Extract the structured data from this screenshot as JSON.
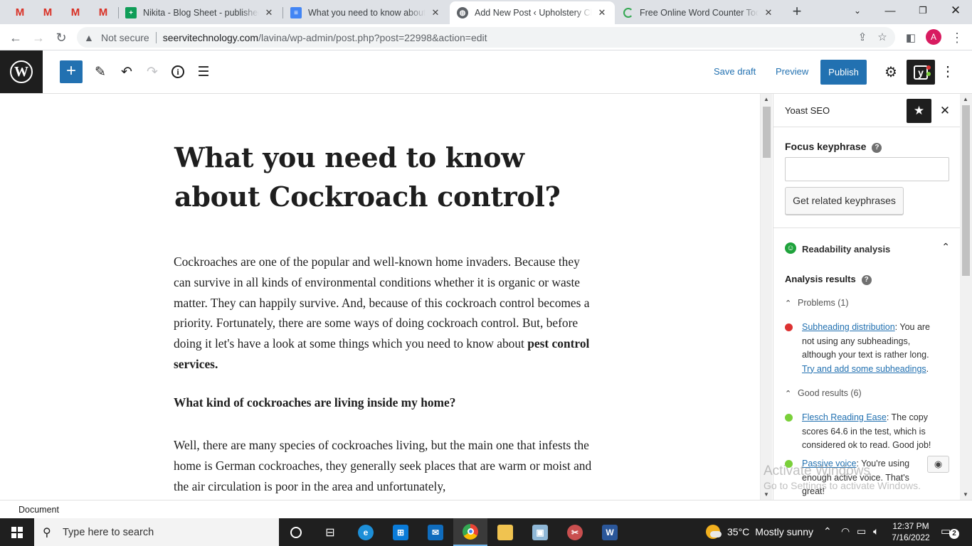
{
  "browser": {
    "pinned_tabs": [
      {
        "icon": "gmail-icon",
        "letter": "M"
      },
      {
        "icon": "gmail-icon",
        "letter": "M"
      },
      {
        "icon": "gmail-icon",
        "letter": "M"
      },
      {
        "icon": "gmail-icon",
        "letter": "M"
      }
    ],
    "tabs": [
      {
        "title": "Nikita - Blog Sheet - published",
        "icon": "google-sheets-icon",
        "color": "#0f9d58",
        "active": false
      },
      {
        "title": "What you need to know about C",
        "icon": "google-docs-icon",
        "color": "#4285f4",
        "active": false
      },
      {
        "title": "Add New Post ‹ Upholstery Clea",
        "icon": "globe-icon",
        "color": "#5f6368",
        "active": true
      },
      {
        "title": "Free Online Word Counter Tool:",
        "icon": "loading-icon",
        "color": "#34a853",
        "active": false
      }
    ],
    "new_tab_glyph": "+",
    "security_label": "Not secure",
    "url_host": "seervitechnology.com",
    "url_path": "/lavina/wp-admin/post.php?post=22998&action=edit",
    "profile_initial": "A"
  },
  "editor": {
    "toolbar": {
      "save_draft": "Save draft",
      "preview": "Preview",
      "publish": "Publish",
      "add_block_glyph": "+"
    },
    "post": {
      "title": "What you need to know about Cockroach control?",
      "intro": "Cockroaches are one of the popular and well-known home invaders. Because they can survive in all kinds of environmental conditions whether it is organic or waste matter. They can happily survive. And, because of this cockroach control becomes a priority. Fortunately, there are some ways of doing cockroach control. But, before doing it let's have a look at some things which you need to know about ",
      "intro_bold": "pest control services.",
      "heading": "What kind of cockroaches are living inside my home?",
      "para2": "Well, there are many species of cockroaches living, but the main one that infests the home is German cockroaches, they generally seek places that are warm or moist and the air circulation is poor in the area and unfortunately,"
    },
    "breadcrumb": "Document"
  },
  "yoast": {
    "panel_title": "Yoast SEO",
    "focus_label": "Focus keyphrase",
    "focus_value": "",
    "related_button": "Get related keyphrases",
    "readability_label": "Readability analysis",
    "analysis_label": "Analysis results",
    "problems_label": "Problems (1)",
    "good_label": "Good results (6)",
    "results": [
      {
        "status": "problem",
        "color": "#dc3232",
        "link": "Subheading distribution",
        "text": ": You are not using any subheadings, although your text is rather long. ",
        "link2": "Try and add some subheadings",
        "tail": "."
      },
      {
        "status": "good",
        "color": "#7ad03a",
        "link": "Flesch Reading Ease",
        "text": ": The copy scores 64.6 in the test, which is considered ok to read. Good job!"
      },
      {
        "status": "good",
        "color": "#7ad03a",
        "link": "Passive voice",
        "text": ": You're using enough active voice. That's great!"
      }
    ]
  },
  "watermark": {
    "line1": "Activate Windows",
    "line2": "Go to Settings to activate Windows."
  },
  "taskbar": {
    "search_placeholder": "Type here to search",
    "weather_temp": "35°C",
    "weather_text": "Mostly sunny",
    "time": "12:37 PM",
    "date": "7/16/2022",
    "notification_count": "2"
  }
}
